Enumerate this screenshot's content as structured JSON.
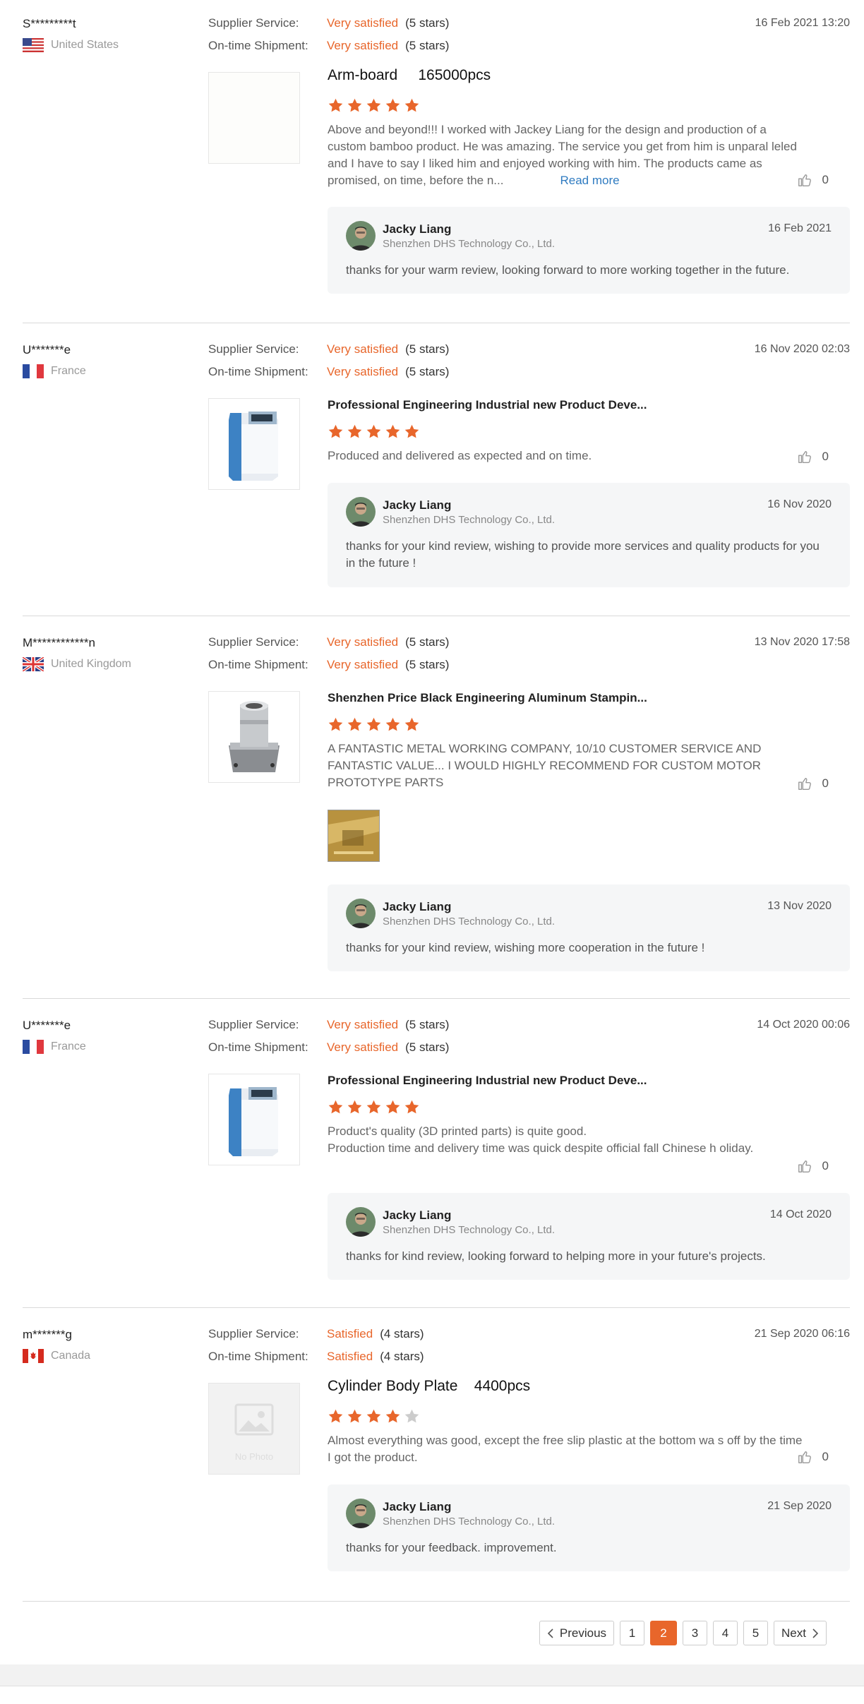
{
  "labels": {
    "supplier_service": "Supplier Service:",
    "ontime_shipment": "On-time Shipment:"
  },
  "colors": {
    "accent": "#e8662b",
    "link": "#2f7bc1",
    "star_empty": "#cccccc"
  },
  "reviews": [
    {
      "user": "S*********t",
      "country": "United States",
      "flag_icon": "us-flag-icon",
      "supplier_service": "Very satisfied",
      "supplier_stars": "(5 stars)",
      "shipment": "Very satisfied",
      "shipment_stars": "(5 stars)",
      "date": "16 Feb 2021 13:20",
      "product": "Arm-board     165000pcs",
      "rating": 5,
      "text": "Above and beyond!!!  I worked with Jackey Liang for the design and production of a custom bamboo product.  He was amazing. The service you get from him is unparal leled and I have to say I liked him and enjoyed working with him. The products came as promised, on time, before the n...",
      "read_more": "Read more",
      "likes": "0",
      "reply": {
        "name": "Jacky Liang",
        "company": "Shenzhen DHS Technology Co., Ltd.",
        "date": "16 Feb 2021",
        "text": "thanks for your warm review, looking forward to more working together in the future."
      }
    },
    {
      "user": "U*******e",
      "country": "France",
      "flag_icon": "france-flag-icon",
      "supplier_service": "Very satisfied",
      "supplier_stars": "(5 stars)",
      "shipment": "Very satisfied",
      "shipment_stars": "(5 stars)",
      "date": "16 Nov 2020 02:03",
      "product": "Professional Engineering Industrial new Product Deve...",
      "rating": 5,
      "text": "Produced and delivered as expected and on time.",
      "likes": "0",
      "reply": {
        "name": "Jacky Liang",
        "company": "Shenzhen DHS Technology Co., Ltd.",
        "date": "16 Nov 2020",
        "text": "thanks for your kind review, wishing to provide more services and quality products for you in the future !"
      }
    },
    {
      "user": "M************n",
      "country": "United Kingdom",
      "flag_icon": "uk-flag-icon",
      "supplier_service": "Very satisfied",
      "supplier_stars": "(5 stars)",
      "shipment": "Very satisfied",
      "shipment_stars": "(5 stars)",
      "date": "13 Nov 2020 17:58",
      "product": "Shenzhen Price Black Engineering Aluminum Stampin...",
      "rating": 5,
      "text": "A FANTASTIC METAL WORKING COMPANY, 10/10 CUSTOMER SERVICE AND FANTASTIC VALUE... I WOULD HIGHLY RECOMMEND FOR CUSTOM MOTOR PROTOTYPE PARTS",
      "likes": "0",
      "reply": {
        "name": "Jacky Liang",
        "company": "Shenzhen DHS Technology Co., Ltd.",
        "date": "13 Nov 2020",
        "text": "thanks for your kind review, wishing more cooperation in the future !"
      }
    },
    {
      "user": "U*******e",
      "country": "France",
      "flag_icon": "france-flag-icon",
      "supplier_service": "Very satisfied",
      "supplier_stars": "(5 stars)",
      "shipment": "Very satisfied",
      "shipment_stars": "(5 stars)",
      "date": "14 Oct 2020 00:06",
      "product": "Professional Engineering Industrial new Product Deve...",
      "rating": 5,
      "text": "Product's quality (3D printed parts) is quite good.\nProduction time and delivery time was quick despite official fall Chinese h oliday.",
      "likes": "0",
      "reply": {
        "name": "Jacky Liang",
        "company": "Shenzhen DHS Technology Co., Ltd.",
        "date": "14 Oct 2020",
        "text": "thanks for kind review, looking forward to helping more in your future's projects."
      }
    },
    {
      "user": "m*******g",
      "country": "Canada",
      "flag_icon": "canada-flag-icon",
      "supplier_service": "Satisfied",
      "supplier_stars": "(4 stars)",
      "shipment": "Satisfied",
      "shipment_stars": "(4 stars)",
      "date": "21 Sep 2020 06:16",
      "product": "Cylinder Body Plate    4400pcs",
      "rating": 4,
      "no_photo": "No Photo",
      "text": "Almost everything was good, except the free slip plastic at the bottom wa s off by the time I got the product.",
      "likes": "0",
      "reply": {
        "name": "Jacky Liang",
        "company": "Shenzhen DHS Technology Co., Ltd.",
        "date": "21 Sep 2020",
        "text": "thanks for your feedback. improvement."
      }
    }
  ],
  "pagination": {
    "previous": "Previous",
    "pages": [
      "1",
      "2",
      "3",
      "4",
      "5"
    ],
    "current": "2",
    "next": "Next"
  }
}
